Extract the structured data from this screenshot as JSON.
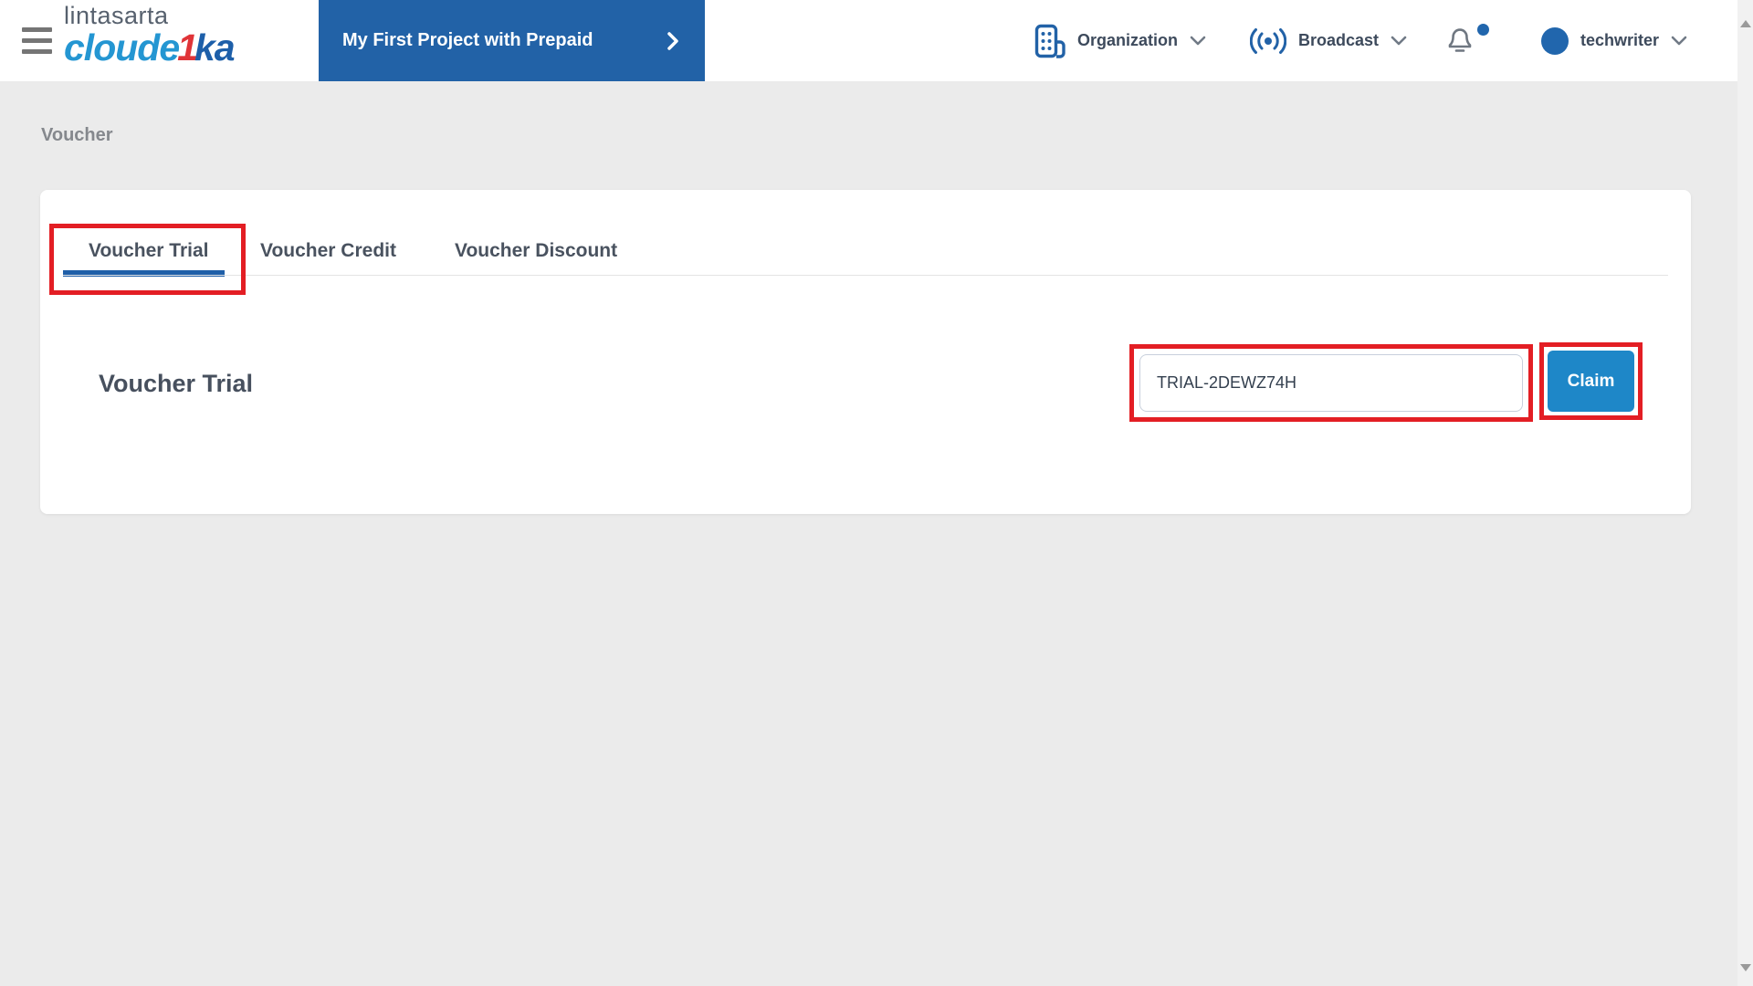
{
  "header": {
    "logo": {
      "brand_top": "lintasarta",
      "brand_main_1": "cloude",
      "brand_accent": "1",
      "brand_main_2": "ka"
    },
    "project_switcher": {
      "label": "My First Project with Prepaid"
    },
    "organization": {
      "label": "Organization"
    },
    "broadcast": {
      "label": "Broadcast"
    },
    "notifications": {
      "unread_indicator": true
    },
    "user": {
      "name": "techwriter"
    }
  },
  "breadcrumb": {
    "label": "Voucher"
  },
  "voucher_card": {
    "tabs": {
      "trial": "Voucher Trial",
      "credit": "Voucher Credit",
      "discount": "Voucher Discount",
      "active": "Voucher Trial"
    },
    "section_title": "Voucher Trial",
    "code_input": {
      "value": "TRIAL-2DEWZ74H"
    },
    "claim_button": {
      "label": "Claim"
    }
  },
  "colors": {
    "brand_blue": "#2262a7",
    "action_blue": "#1e87c8",
    "accent_red": "#e03438",
    "annotation_red": "#e31e24",
    "tab_underline_blue": "#1f5fa8"
  }
}
